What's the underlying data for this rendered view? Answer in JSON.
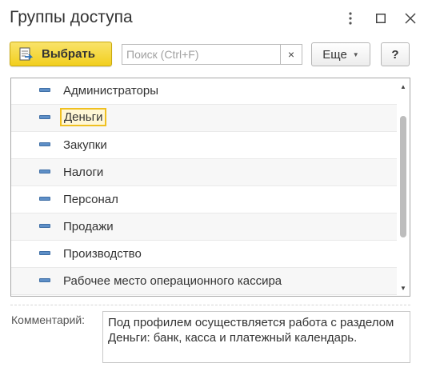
{
  "window": {
    "title": "Группы доступа",
    "controls": [
      "more-vertical-icon",
      "maximize-icon",
      "close-icon"
    ]
  },
  "toolbar": {
    "select_label": "Выбрать",
    "select_icon": "select-arrow-icon",
    "search_placeholder": "Поиск (Ctrl+F)",
    "search_value": "",
    "clear_label": "×",
    "more_label": "Еще",
    "help_label": "?"
  },
  "list": {
    "items": [
      {
        "label": "Администраторы"
      },
      {
        "label": "Деньги",
        "current": true
      },
      {
        "label": "Закупки"
      },
      {
        "label": "Налоги"
      },
      {
        "label": "Персонал"
      },
      {
        "label": "Продажи"
      },
      {
        "label": "Производство"
      },
      {
        "label": "Рабочее место операционного кассира"
      }
    ]
  },
  "comment": {
    "label": "Комментарий:",
    "text": "Под профилем осуществляется работа с разделом Деньги: банк, касса и платежный календарь."
  },
  "colors": {
    "accent_button": "#f2cf1e",
    "item_marker": "#5e8fc7",
    "current_highlight": "#f0c020"
  }
}
